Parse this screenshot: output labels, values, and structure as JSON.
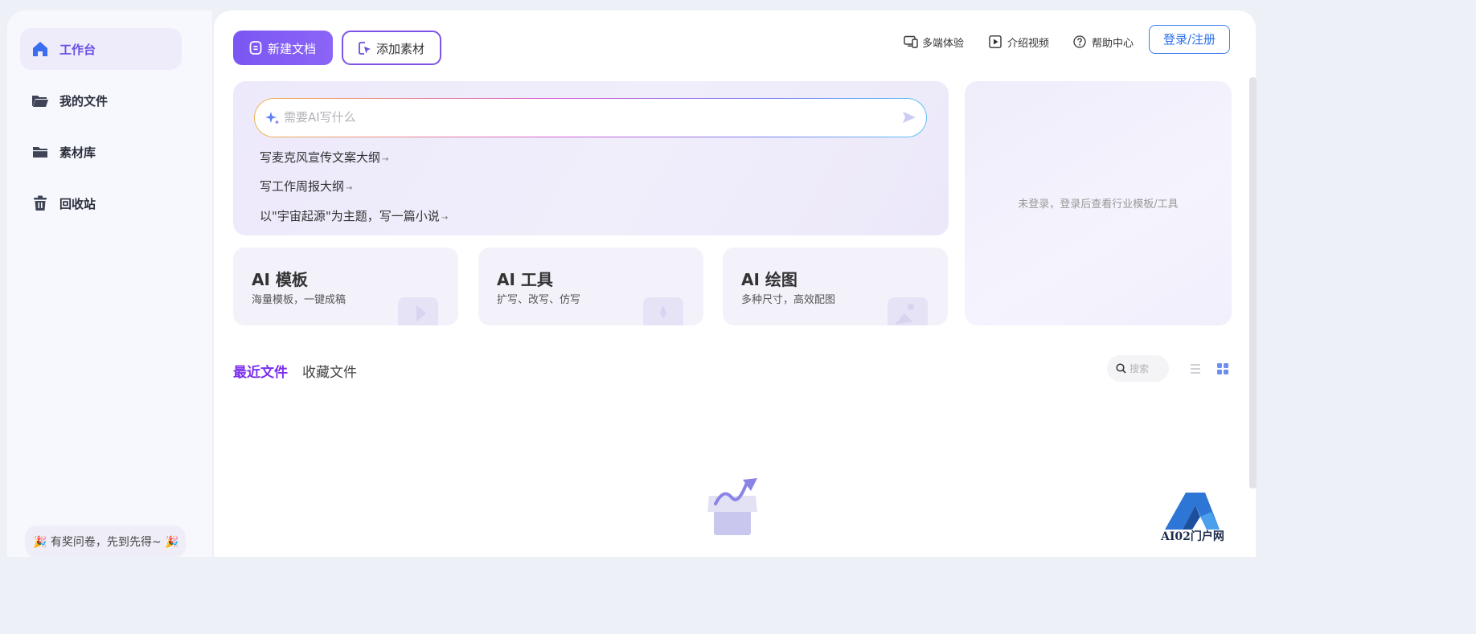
{
  "sidebar": {
    "items": [
      {
        "label": "工作台",
        "icon": "home-icon",
        "active": true
      },
      {
        "label": "我的文件",
        "icon": "folder-open-icon",
        "active": false
      },
      {
        "label": "素材库",
        "icon": "folder-icon",
        "active": false
      },
      {
        "label": "回收站",
        "icon": "trash-icon",
        "active": false
      }
    ],
    "promo": "🎉 有奖问卷，先到先得~ 🎉"
  },
  "toolbar": {
    "new_doc": "新建文档",
    "add_material": "添加素材",
    "multi_device": "多端体验",
    "intro_video": "介绍视频",
    "help_center": "帮助中心",
    "login": "登录/注册"
  },
  "ai": {
    "placeholder": "需要AI写什么",
    "suggestions": [
      "写麦克风宣传文案大纲",
      "写工作周报大纲",
      "以\"宇宙起源\"为主题，写一篇小说"
    ],
    "arrow": "→"
  },
  "info_panel": {
    "message": "未登录，登录后查看行业模板/工具"
  },
  "features": [
    {
      "title": "AI 模板",
      "subtitle": "海量模板，一键成稿"
    },
    {
      "title": "AI 工具",
      "subtitle": "扩写、改写、仿写"
    },
    {
      "title": "AI 绘图",
      "subtitle": "多种尺寸，高效配图"
    }
  ],
  "files": {
    "tab_recent": "最近文件",
    "tab_favorites": "收藏文件",
    "search_placeholder": "搜索"
  },
  "watermark": "AI02门户网",
  "colors": {
    "accent": "#7b57f2",
    "link_blue": "#2a6fea",
    "tab_active": "#7b2ff0"
  }
}
